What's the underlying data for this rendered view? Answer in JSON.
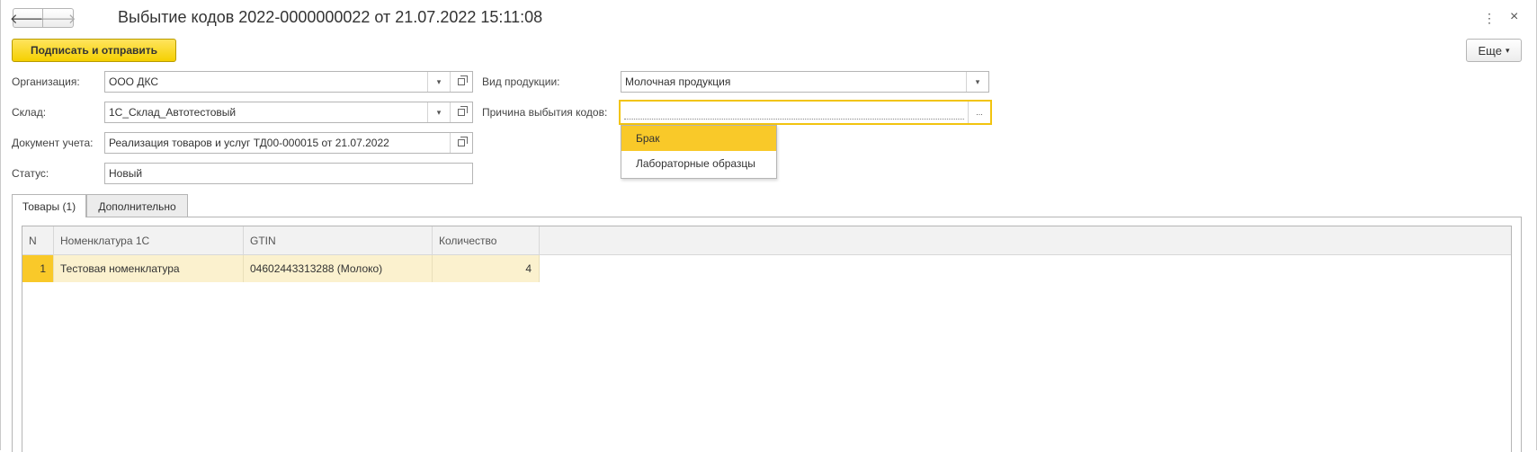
{
  "window": {
    "title": "Выбытие кодов 2022-0000000022 от 21.07.2022 15:11:08",
    "back_glyph": "🡐",
    "forward_glyph": "🡒",
    "menu_glyph": "⋮",
    "close_glyph": "×"
  },
  "toolbar": {
    "sign_label": "Подписать и отправить",
    "more_label": "Еще",
    "more_arrow": "▾"
  },
  "form": {
    "organization": {
      "label": "Организация:",
      "value": "ООО ДКС"
    },
    "warehouse": {
      "label": "Склад:",
      "value": "1С_Склад_Автотестовый"
    },
    "document": {
      "label": "Документ учета:",
      "value": "Реализация товаров и услуг ТД00-000015 от 21.07.2022"
    },
    "status": {
      "label": "Статус:",
      "value": "Новый"
    },
    "product_type": {
      "label": "Вид продукции:",
      "value": "Молочная продукция"
    },
    "reason": {
      "label": "Причина выбытия кодов:",
      "value": "",
      "select_glyph": "..."
    },
    "dropdown_glyph": "▾"
  },
  "reason_dropdown": {
    "options": [
      "Брак",
      "Лабораторные образцы"
    ],
    "selected": "Брак"
  },
  "tabs": [
    {
      "label": "Товары (1)",
      "active": true
    },
    {
      "label": "Дополнительно",
      "active": false
    }
  ],
  "table": {
    "columns": [
      "N",
      "Номенклатура 1С",
      "GTIN",
      "Количество"
    ],
    "rows": [
      {
        "n": "1",
        "nomenclature": "Тестовая номенклатура",
        "gtin": "04602443313288 (Молоко)",
        "quantity": "4"
      }
    ]
  },
  "colors": {
    "accent": "#f5d000",
    "selected_row": "#fbf1ce",
    "focus": "#f2c40f"
  }
}
